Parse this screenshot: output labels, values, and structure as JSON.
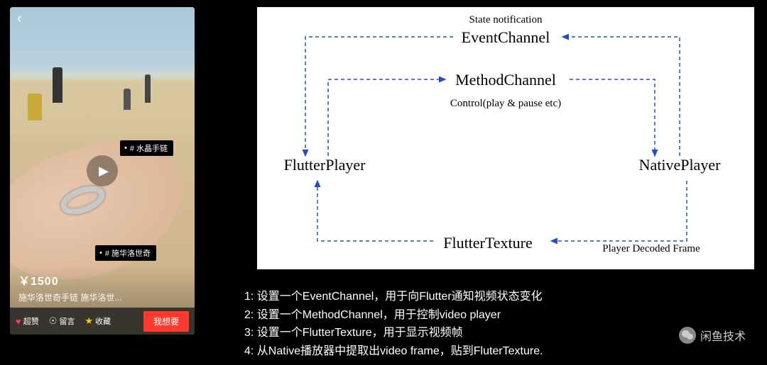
{
  "phone": {
    "tags": [
      "# 水晶手链",
      "# 施华洛世奇"
    ],
    "price": "￥1500",
    "desc": "施华洛世奇手链 施华洛世...",
    "actions": {
      "like": "超赞",
      "comment": "留言",
      "fav": "收藏",
      "want": "我想要"
    }
  },
  "diagram": {
    "state_label": "State notification",
    "event": "EventChannel",
    "method": "MethodChannel",
    "control_label": "Control(play & pause etc)",
    "flutter_player": "FlutterPlayer",
    "native_player": "NativePlayer",
    "flutter_texture": "FlutterTexture",
    "decoded_label": "Player Decoded Frame"
  },
  "notes": {
    "n1": "1: 设置一个EventChannel，用于向Flutter通知视频状态变化",
    "n2": "2: 设置一个MethodChannel，用于控制video player",
    "n3": "3: 设置一个FlutterTexture，用于显示视频帧",
    "n4": "4: 从Native播放器中提取出video frame，贴到FluterTexture."
  },
  "brand": "闲鱼技术"
}
